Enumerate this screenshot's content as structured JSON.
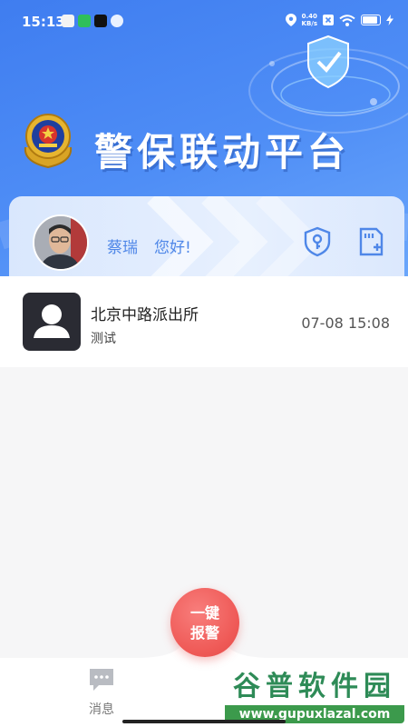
{
  "status_bar": {
    "time": "15:13",
    "net_speed_value": "0.40",
    "net_speed_unit": "KB/s"
  },
  "header": {
    "title": "警保联动平台"
  },
  "user": {
    "name": "蔡瑞",
    "greeting": "您好!"
  },
  "messages": [
    {
      "title": "北京中路派出所",
      "subtitle": "测试",
      "time": "07-08 15:08"
    }
  ],
  "sos_button": {
    "line1": "一键",
    "line2": "报警"
  },
  "tabbar": {
    "messages_label": "消息"
  },
  "watermark": {
    "main": "谷普软件园",
    "sub": "www.gupuxlazal.com"
  },
  "colors": {
    "hero_blue": "#4f8ef6",
    "accent_text": "#4f87e8",
    "sos_red": "#ef5a57",
    "watermark_green": "#3c9a4c"
  },
  "icons": {
    "status": [
      "location-icon",
      "close-box-icon",
      "wifi-icon",
      "battery-icon",
      "charging-icon"
    ],
    "card": [
      "shield-key-icon",
      "sd-card-icon"
    ],
    "tab": [
      "chat-bubble-icon"
    ]
  }
}
